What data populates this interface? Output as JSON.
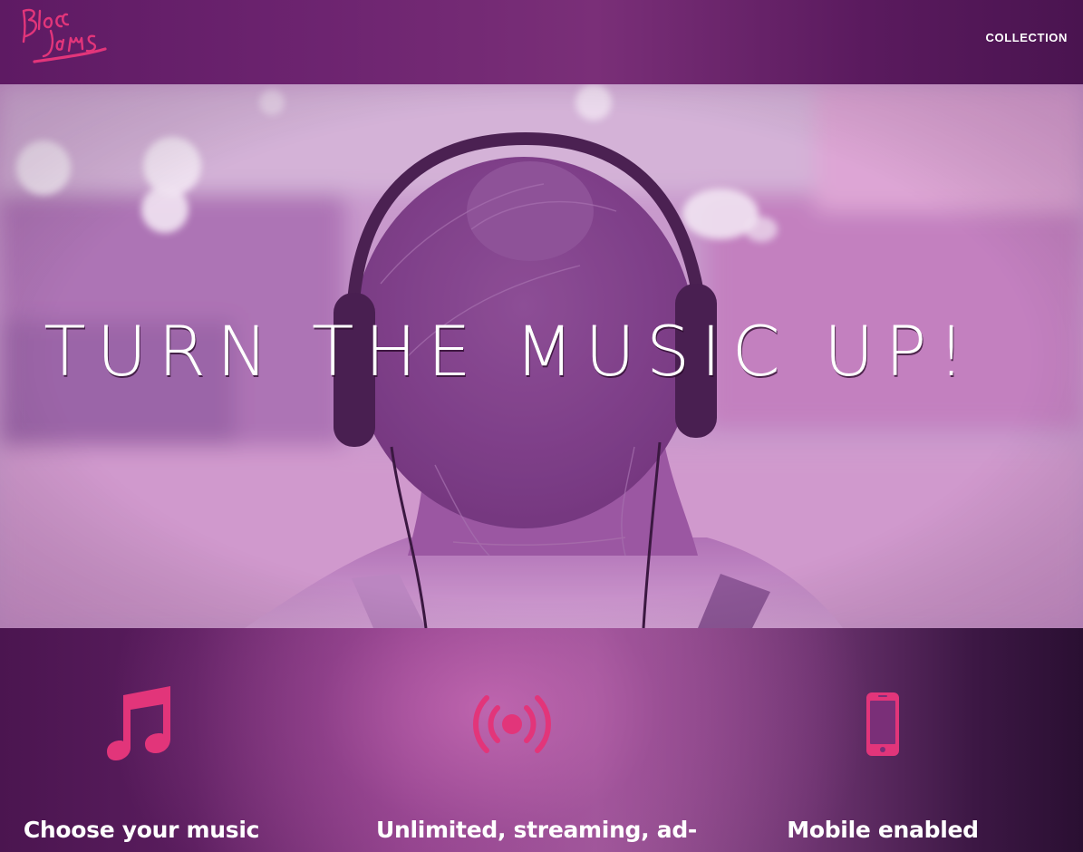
{
  "navbar": {
    "logo_text": "Bloc Jams",
    "collection_label": "COLLECTION"
  },
  "hero": {
    "title": "TURN THE MUSIC UP!"
  },
  "selling_points": [
    {
      "icon": "music-note-icon",
      "title": "Choose your music"
    },
    {
      "icon": "broadcast-icon",
      "title": "Unlimited, streaming, ad-"
    },
    {
      "icon": "mobile-phone-icon",
      "title": "Mobile enabled"
    }
  ],
  "colors": {
    "navbar": "#6d2470",
    "accent_pink": "#e2357a",
    "hero_tint": "#c8a2cf",
    "text_white": "#ffffff"
  }
}
